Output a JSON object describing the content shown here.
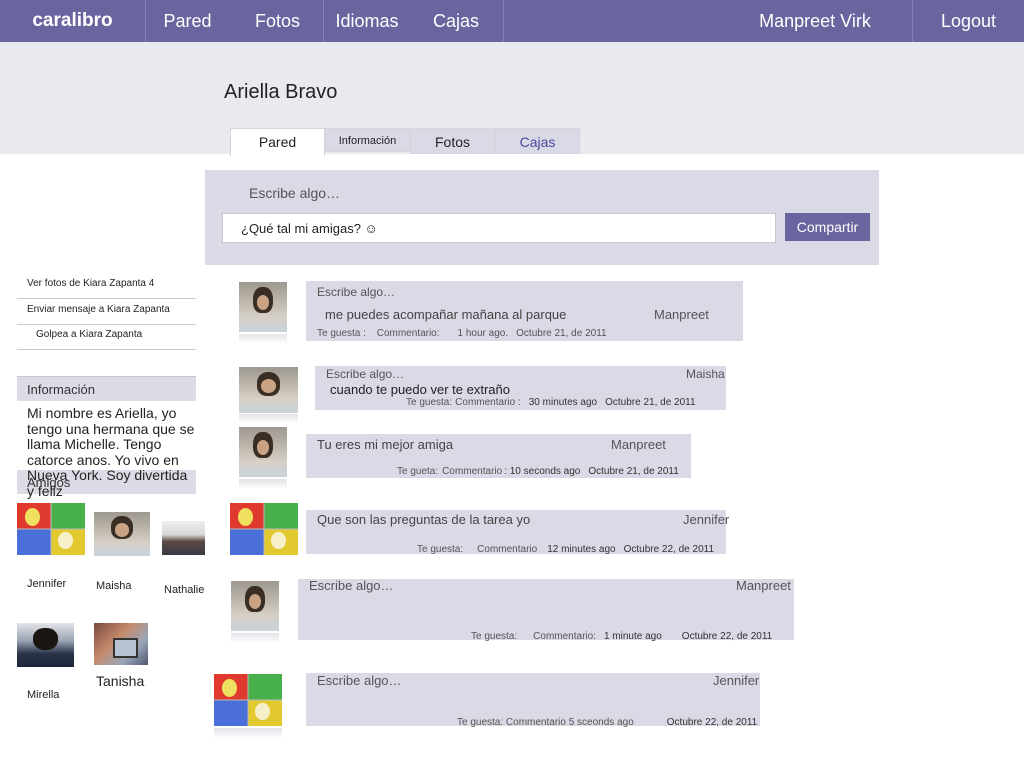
{
  "nav": {
    "brand": "caralibro",
    "items": [
      "Pared",
      "Fotos",
      "Idiomas",
      "Cajas"
    ],
    "user": "Manpreet Virk",
    "logout": "Logout"
  },
  "profile": {
    "name": "Ariella Bravo",
    "tabs": [
      "Pared",
      "Información",
      "Fotos",
      "Cajas"
    ]
  },
  "composer": {
    "label": "Escribe algo…",
    "input_value": "¿Qué tal mi amigas? ☺",
    "share_label": "Compartir"
  },
  "sidebar": {
    "links": [
      "Ver fotos de Kiara Zapanta 4",
      "Enviar mensaje a Kiara Zapanta",
      "Golpea a Kiara Zapanta"
    ],
    "info_heading": "Información",
    "info_text": "Mi nombre es Ariella, yo tengo una hermana que se llama Michelle. Tengo catorce anos. Yo vivo en Nueva York. Soy divertida y feliz",
    "friends_heading": "Amigos",
    "friends": [
      "Jennifer",
      "Maisha",
      "Nathalie",
      "Mirella",
      "Tanisha"
    ]
  },
  "posts": [
    {
      "label": "Escribe algo…",
      "text": "me puedes acompañar mañana al parque",
      "author": "Manpreet",
      "meta_like": "Te guesta",
      "meta_sep": " : ",
      "meta_comment": "Commentario:",
      "meta_time": "1 hour ago.",
      "meta_date": "Octubre 21, de 2011"
    },
    {
      "label": "Escribe algo…",
      "text": "cuando te puedo ver te extraño",
      "author": "Maisha",
      "meta_like": "Te guesta:",
      "meta_comment": "Commentario :",
      "meta_time": "30 minutes ago",
      "meta_date": "Octubre 21, de 2011"
    },
    {
      "text": "Tu eres mi mejor amiga",
      "author": "Manpreet",
      "meta_like": "Te gueta:",
      "meta_comment": "Commentario",
      "meta_time": ": 10 seconds ago",
      "meta_date": "Octubre 21,  de 2011"
    },
    {
      "text": "Que son las preguntas de la tarea yo",
      "author": "Jennifer",
      "meta_like": "Te guesta:",
      "meta_comment": "Commentario",
      "meta_time": "12  minutes ago",
      "meta_date": "Octubre 22, de 2011"
    },
    {
      "label": "Escribe algo…",
      "author": "Manpreet",
      "meta_like": "Te guesta:",
      "meta_comment": "Commentario:",
      "meta_time": "1 minute ago",
      "meta_date": "Octubre 22, de 2011"
    },
    {
      "label": "Escribe algo…",
      "author": "Jennifer",
      "meta_like": "Te guesta: Commentario 5 sceonds ago",
      "meta_date": "Octubre 22, de 2011"
    }
  ]
}
